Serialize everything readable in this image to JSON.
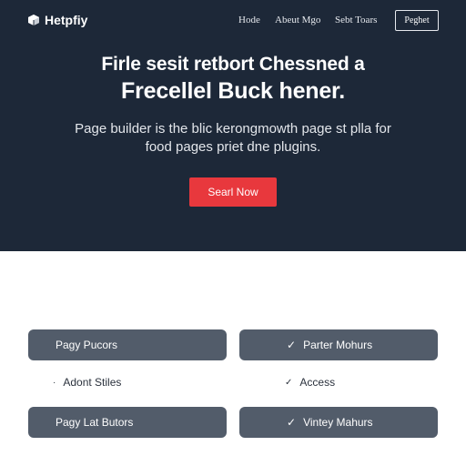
{
  "brand": {
    "name": "Hetpfiy",
    "icon": "cube-logo-icon"
  },
  "nav": {
    "links": [
      "Hode",
      "Abeut Mgo",
      "Sebt Toars"
    ],
    "button_label": "Peghet"
  },
  "hero": {
    "headline_line1": "Firle sesit retbort Chessned a",
    "headline_line2": "Frecellel Buck hener.",
    "subtext_line1": "Page builder is the blic kerongmowth page st plla for",
    "subtext_line2": "food pages priet dne plugins.",
    "cta_label": "Searl Now"
  },
  "features": {
    "pill1": "Pagy Pucors",
    "pill2": "Parter Mohurs",
    "plain1": "Adont Stiles",
    "plain2": "Access",
    "pill3": "Pagy Lat Butors",
    "pill4": "Vintey Mahurs"
  },
  "colors": {
    "hero_bg": "#1d2838",
    "accent": "#e8383d",
    "pill_bg": "#525c6a"
  }
}
